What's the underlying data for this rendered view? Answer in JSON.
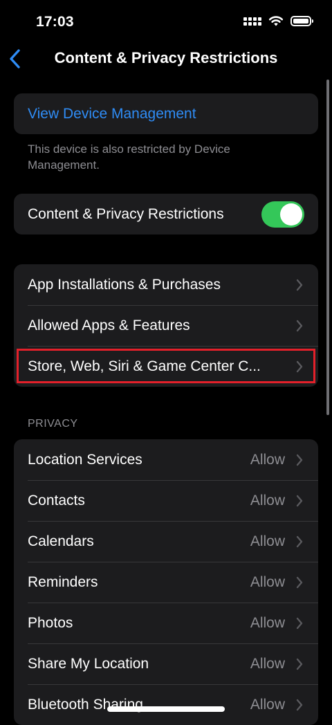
{
  "status_bar": {
    "time": "17:03"
  },
  "nav": {
    "title": "Content & Privacy Restrictions"
  },
  "device_management": {
    "link_label": "View Device Management",
    "note": "This device is also restricted by Device Management."
  },
  "restrictions_toggle": {
    "label": "Content & Privacy Restrictions",
    "state": "on",
    "color": "#34c759"
  },
  "main_items": [
    {
      "label": "App Installations & Purchases"
    },
    {
      "label": "Allowed Apps & Features"
    },
    {
      "label": "Store, Web, Siri & Game Center C..."
    }
  ],
  "highlight": {
    "target": "Store, Web, Siri & Game Center C...",
    "color": "#e3202a"
  },
  "privacy": {
    "header": "PRIVACY",
    "items": [
      {
        "label": "Location Services",
        "value": "Allow"
      },
      {
        "label": "Contacts",
        "value": "Allow"
      },
      {
        "label": "Calendars",
        "value": "Allow"
      },
      {
        "label": "Reminders",
        "value": "Allow"
      },
      {
        "label": "Photos",
        "value": "Allow"
      },
      {
        "label": "Share My Location",
        "value": "Allow"
      },
      {
        "label": "Bluetooth Sharing",
        "value": "Allow"
      }
    ]
  },
  "colors": {
    "accent": "#2f8cf5",
    "background": "#000000",
    "cell": "#1c1c1e"
  }
}
